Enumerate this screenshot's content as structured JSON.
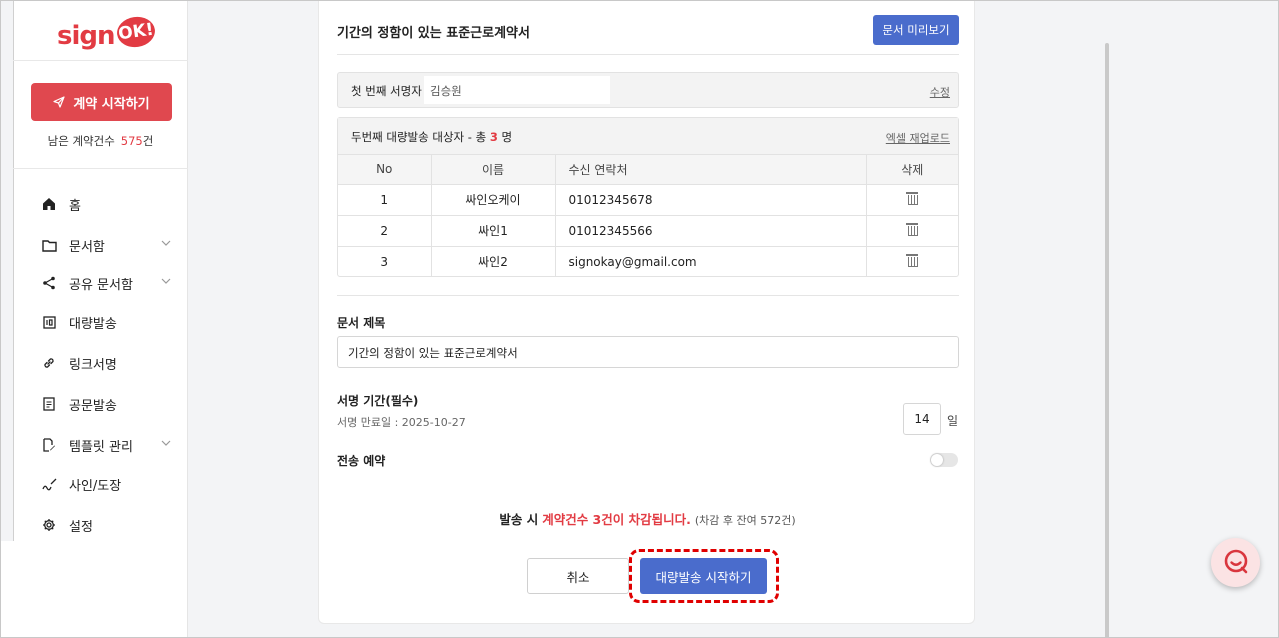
{
  "brand": {
    "logo_text": "sign",
    "logo_badge": "OK!",
    "accent": "#e23b43",
    "primary": "#4a6ccc"
  },
  "sidebar": {
    "start_button": "계약 시작하기",
    "remaining_label": "남은 계약건수",
    "remaining_count": "575",
    "remaining_unit": "건",
    "items": [
      {
        "label": "홈",
        "icon": "home-icon",
        "expandable": false
      },
      {
        "label": "문서함",
        "icon": "folder-icon",
        "expandable": true
      },
      {
        "label": "공유 문서함",
        "icon": "share-icon",
        "expandable": true
      },
      {
        "label": "대량발송",
        "icon": "bulk-send-icon",
        "expandable": false
      },
      {
        "label": "링크서명",
        "icon": "link-icon",
        "expandable": false
      },
      {
        "label": "공문발송",
        "icon": "document-icon",
        "expandable": false
      },
      {
        "label": "템플릿 관리",
        "icon": "template-icon",
        "expandable": true
      },
      {
        "label": "사인/도장",
        "icon": "signature-icon",
        "expandable": false
      },
      {
        "label": "설정",
        "icon": "gear-icon",
        "expandable": false
      }
    ]
  },
  "main": {
    "doc_title": "기간의 정함이 있는 표준근로계약서",
    "preview_button": "문서 미리보기",
    "first_signer": {
      "label": "첫 번째 서명자",
      "name": "김승원",
      "edit": "수정"
    },
    "bulk": {
      "title_prefix": "두번째 대량발송 대상자 - 총",
      "count": "3",
      "title_suffix": "명",
      "reupload": "엑셀 재업로드",
      "columns": [
        "No",
        "이름",
        "수신 연락처",
        "삭제"
      ],
      "rows": [
        {
          "no": "1",
          "name": "싸인오케이",
          "contact": "01012345678"
        },
        {
          "no": "2",
          "name": "싸인1",
          "contact": "01012345566"
        },
        {
          "no": "3",
          "name": "싸인2",
          "contact": "signokay@gmail.com"
        }
      ]
    },
    "doc_title_field": {
      "label": "문서 제목",
      "value": "기간의 정함이 있는 표준근로계약서"
    },
    "sign_period": {
      "label": "서명 기간(필수)",
      "expire": "서명 만료일 : 2025-10-27",
      "days": "14",
      "unit": "일"
    },
    "schedule": {
      "label": "전송 예약",
      "enabled": false
    },
    "notice": {
      "prefix": "발송 시",
      "highlight": "계약건수 3건이 차감됩니다.",
      "sub": "(차감 후 잔여 572건)"
    },
    "cancel_button": "취소",
    "send_button": "대량발송 시작하기"
  },
  "chat": {
    "icon": "chat-icon"
  }
}
